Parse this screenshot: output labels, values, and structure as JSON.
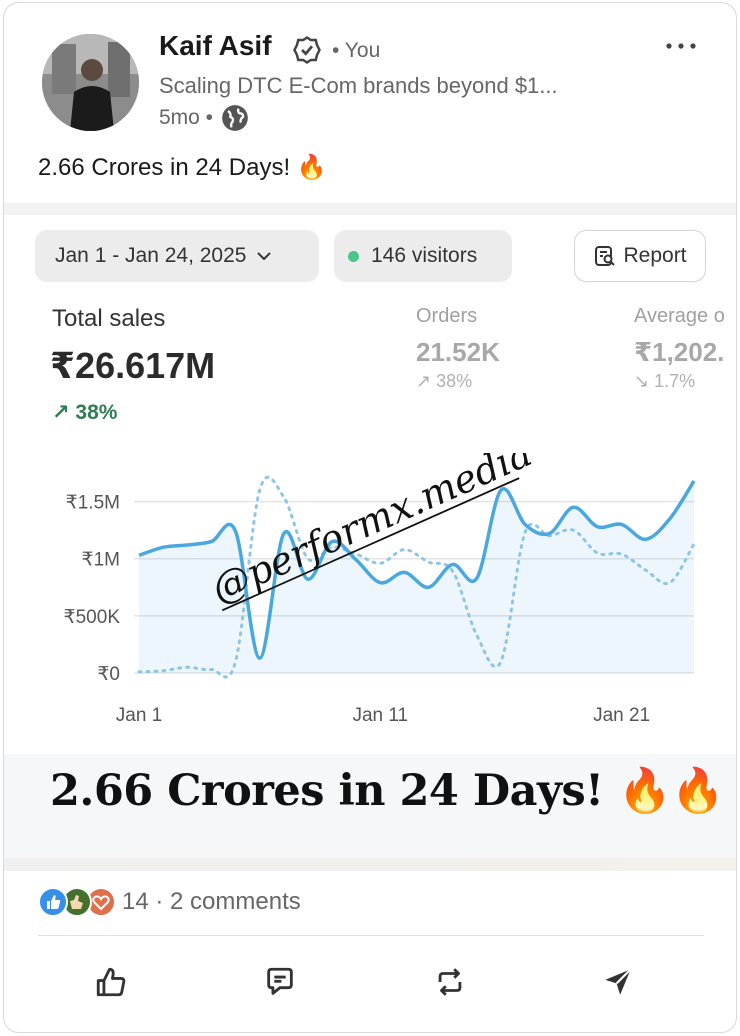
{
  "post": {
    "author": {
      "name": "Kaif Asif",
      "relation": "• You",
      "headline": "Scaling DTC E-Com brands beyond $1...",
      "age": "5mo •",
      "visibility_icon": "globe-icon"
    },
    "more_icon": "more-dots-icon",
    "text": "2.66 Crores in 24 Days! 🔥"
  },
  "dashboard": {
    "date_range": "Jan 1 - Jan 24, 2025",
    "visitors": "146 visitors",
    "report_label": "Report",
    "metrics": {
      "total_sales": {
        "label": "Total sales",
        "value": "₹26.617M",
        "delta": "↗ 38%"
      },
      "orders": {
        "label": "Orders",
        "value": "21.52K",
        "delta": "↗ 38%"
      },
      "aov": {
        "label": "Average o",
        "value": "₹1,202.",
        "delta": "↘ 1.7%"
      }
    },
    "watermark": "@performx.media",
    "banner_text": "2.66 Crores in 24 Days! 🔥🔥",
    "colors": {
      "current_series": "#4aa8de",
      "previous_series": "#8fc6e6",
      "up_delta": "#2f7d52"
    }
  },
  "chart_data": {
    "type": "line",
    "x": [
      "Jan 1",
      "Jan 2",
      "Jan 3",
      "Jan 4",
      "Jan 5",
      "Jan 6",
      "Jan 7",
      "Jan 8",
      "Jan 9",
      "Jan 10",
      "Jan 11",
      "Jan 12",
      "Jan 13",
      "Jan 14",
      "Jan 15",
      "Jan 16",
      "Jan 17",
      "Jan 18",
      "Jan 19",
      "Jan 20",
      "Jan 21",
      "Jan 22",
      "Jan 23",
      "Jan 24"
    ],
    "x_ticks": [
      "Jan 1",
      "Jan 11",
      "Jan 21"
    ],
    "y_ticks": [
      "₹0",
      "₹500K",
      "₹1M",
      "₹1.5M"
    ],
    "ylim": [
      0,
      1750000
    ],
    "series": [
      {
        "values": [
          1030000,
          1100000,
          1120000,
          1150000,
          1240000,
          130000,
          1220000,
          820000,
          1150000,
          990000,
          790000,
          880000,
          750000,
          950000,
          830000,
          1600000,
          1300000,
          1220000,
          1450000,
          1280000,
          1300000,
          1170000,
          1350000,
          1680000
        ]
      },
      {
        "values": [
          10000,
          20000,
          50000,
          30000,
          100000,
          1600000,
          1540000,
          1000000,
          1100000,
          1040000,
          960000,
          1080000,
          970000,
          890000,
          330000,
          100000,
          1230000,
          1200000,
          1250000,
          1050000,
          1040000,
          900000,
          790000,
          1130000
        ]
      }
    ]
  },
  "footer": {
    "reaction_icons": [
      "like-reaction-icon",
      "celebrate-reaction-icon",
      "love-reaction-icon"
    ],
    "counts": "14 · 2 comments",
    "actions": [
      "like-icon",
      "comment-icon",
      "repost-icon",
      "send-icon"
    ]
  }
}
